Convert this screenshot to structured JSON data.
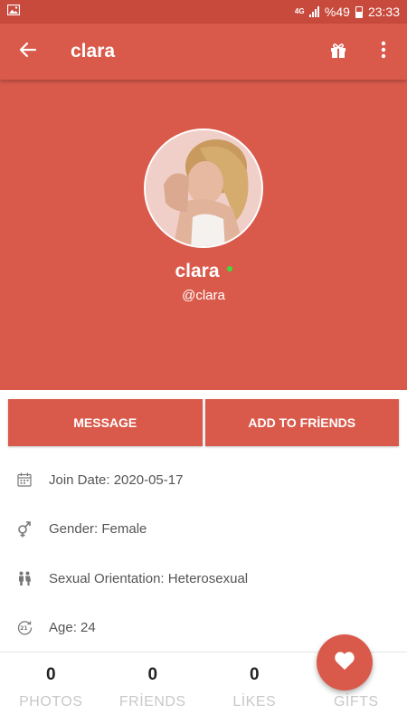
{
  "status_bar": {
    "network": "4G",
    "battery": "%49",
    "time": "23:33",
    "left_icon": "image-icon"
  },
  "app_bar": {
    "title": "clara",
    "back_icon": "arrow-back-icon",
    "gift_icon": "gift-icon",
    "menu_icon": "more-vert-icon"
  },
  "profile": {
    "name": "clara",
    "handle": "@clara",
    "online": true
  },
  "actions": {
    "message_label": "MESSAGE",
    "add_friend_label": "ADD TO FRİENDS"
  },
  "info": {
    "join_date": "Join Date: 2020-05-17",
    "gender": "Gender: Female",
    "orientation": "Sexual Orientation: Heterosexual",
    "age": "Age: 24"
  },
  "stats": [
    {
      "count": "0",
      "label": "PHOTOS"
    },
    {
      "count": "0",
      "label": "FRİENDS"
    },
    {
      "count": "0",
      "label": "LİKES"
    },
    {
      "count": "",
      "label": "GİFTS"
    }
  ],
  "colors": {
    "primary": "#d95a4b",
    "status_bar": "#c84a3d",
    "online": "#3ddc3d"
  }
}
